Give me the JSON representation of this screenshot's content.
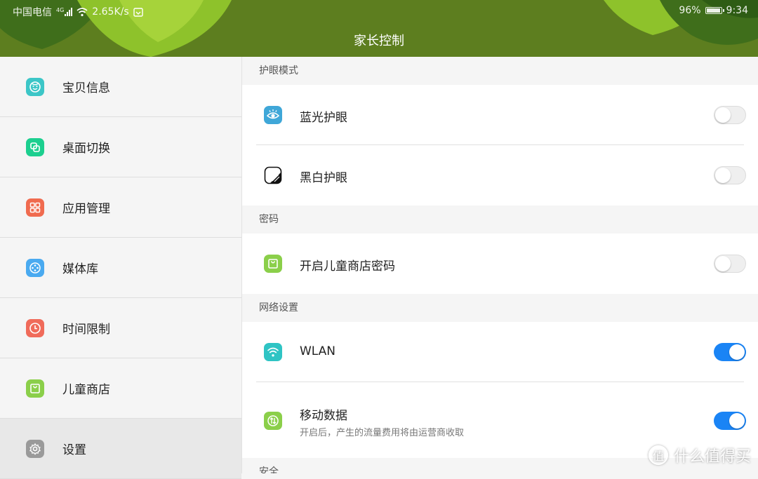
{
  "status_bar": {
    "carrier": "中国电信",
    "network_type": "4G",
    "speed": "2.65K/s",
    "battery": "96%",
    "time": "9:34"
  },
  "header": {
    "title": "家长控制"
  },
  "sidebar": {
    "items": [
      {
        "label": "宝贝信息",
        "icon": "baby-face-icon",
        "color": "#3cc6c7"
      },
      {
        "label": "桌面切换",
        "icon": "desktop-switch-icon",
        "color": "#1ccf8f"
      },
      {
        "label": "应用管理",
        "icon": "app-grid-icon",
        "color": "#f06b4f"
      },
      {
        "label": "媒体库",
        "icon": "media-reel-icon",
        "color": "#4aaaf0"
      },
      {
        "label": "时间限制",
        "icon": "clock-icon",
        "color": "#f06b5a"
      },
      {
        "label": "儿童商店",
        "icon": "shopping-bag-icon",
        "color": "#8bcf4a"
      },
      {
        "label": "设置",
        "icon": "gear-icon",
        "color": "#9a9a9a"
      }
    ],
    "active_index": 6
  },
  "sections": {
    "eye": {
      "header": "护眼模式",
      "rows": [
        {
          "label": "蓝光护眼",
          "icon": "eye-icon",
          "enabled": false
        },
        {
          "label": "黑白护眼",
          "icon": "grayscale-icon",
          "enabled": false
        }
      ]
    },
    "password": {
      "header": "密码",
      "rows": [
        {
          "label": "开启儿童商店密码",
          "icon": "shopping-bag-icon",
          "enabled": false
        }
      ]
    },
    "network": {
      "header": "网络设置",
      "rows": [
        {
          "label": "WLAN",
          "icon": "wifi-icon",
          "enabled": true
        },
        {
          "label": "移动数据",
          "sub": "开启后，产生的流量费用将由运营商收取",
          "icon": "mobile-data-icon",
          "enabled": true
        }
      ]
    },
    "security": {
      "header": "安全"
    }
  },
  "colors": {
    "header_bg": "#5d7e1f",
    "toggle_on": "#1a84f5"
  },
  "watermark": {
    "text": "什么值得买",
    "mark": "值"
  }
}
